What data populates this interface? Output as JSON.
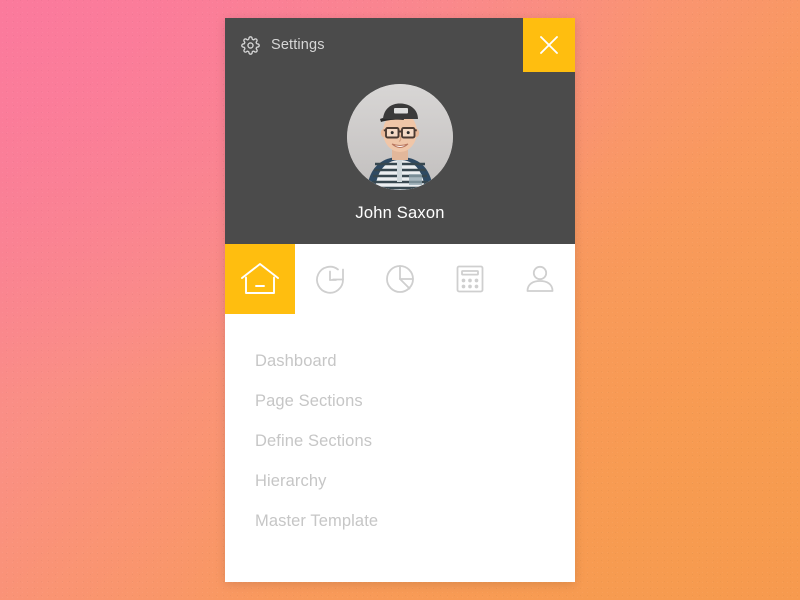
{
  "window": {
    "title": "Settings",
    "gear_icon": "gear-icon",
    "close_icon": "close-x-icon",
    "close_label": "Close"
  },
  "profile": {
    "name": "John Saxon",
    "avatar_alt": "avatar-photo"
  },
  "tabs": [
    {
      "id": "home",
      "icon": "home-icon",
      "label": "Home",
      "active": true
    },
    {
      "id": "history",
      "icon": "history-icon",
      "label": "History",
      "active": false
    },
    {
      "id": "reports",
      "icon": "pie-chart-icon",
      "label": "Reports",
      "active": false
    },
    {
      "id": "calendar",
      "icon": "calendar-icon",
      "label": "Calendar",
      "active": false
    },
    {
      "id": "account",
      "icon": "person-icon",
      "label": "Account",
      "active": false
    }
  ],
  "menu": {
    "items": [
      {
        "label": "Dashboard"
      },
      {
        "label": "Page Sections"
      },
      {
        "label": "Define Sections"
      },
      {
        "label": "Hierarchy"
      },
      {
        "label": "Master Template"
      }
    ]
  },
  "colors": {
    "accent": "#ffbe0f",
    "panel_dark": "#4b4b4b",
    "card_bg": "#ffffff",
    "menu_text": "#c6c6c6",
    "title_text": "#d6d6d6",
    "icon_inactive": "#cfcfcf",
    "bg_pink": "#fa7d99",
    "bg_orange": "#f6a04f"
  }
}
